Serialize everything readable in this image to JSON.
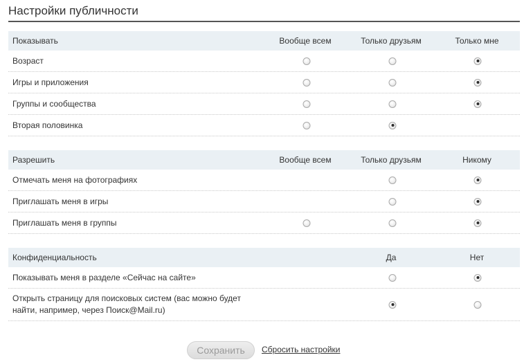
{
  "title": "Настройки публичности",
  "show": {
    "header": {
      "label": "Показывать",
      "col1": "Вообще всем",
      "col2": "Только друзьям",
      "col3": "Только мне"
    },
    "rows": [
      {
        "label": "Возраст",
        "selected": 3
      },
      {
        "label": "Игры и приложения",
        "selected": 3
      },
      {
        "label": "Группы и сообщества",
        "selected": 3
      },
      {
        "label": "Вторая половинка",
        "selected": 2
      }
    ]
  },
  "allow": {
    "header": {
      "label": "Разрешить",
      "col1": "Вообще всем",
      "col2": "Только друзьям",
      "col3": "Никому"
    },
    "rows": [
      {
        "label": "Отмечать меня на фотографиях",
        "selected": 3
      },
      {
        "label": "Приглашать меня в игры",
        "selected": 3
      },
      {
        "label": "Приглашать меня в группы",
        "selected": 3
      }
    ]
  },
  "privacy": {
    "header": {
      "label": "Конфиденциальность",
      "yes": "Да",
      "no": "Нет"
    },
    "rows": [
      {
        "label": "Показывать меня в разделе «Сейчас на сайте»",
        "selected": "no"
      },
      {
        "label": "Открыть страницу для поисковых систем (вас можно будет найти, например, через Поиск@Mail.ru)",
        "selected": "yes"
      }
    ]
  },
  "footer": {
    "save_label": "Сохранить",
    "reset_label": "Сбросить настройки"
  }
}
